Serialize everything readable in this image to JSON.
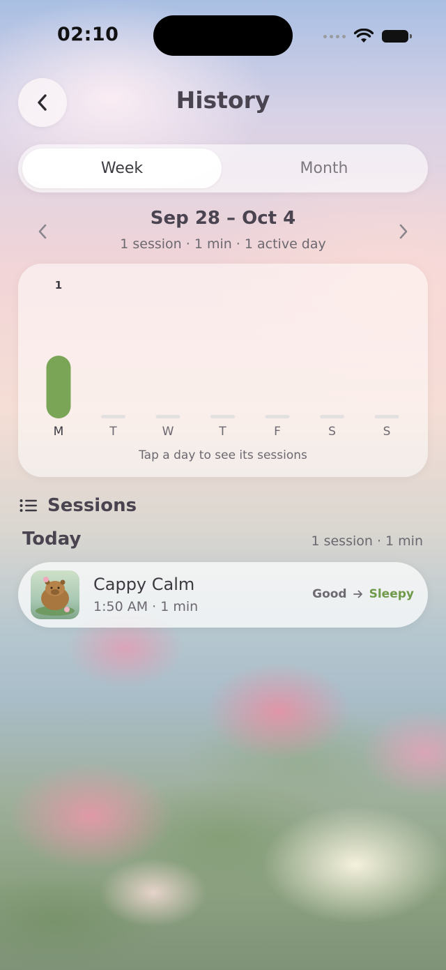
{
  "status_bar": {
    "time": "02:10"
  },
  "header": {
    "title": "History"
  },
  "tabs": {
    "week": "Week",
    "month": "Month",
    "selected": "Week"
  },
  "range": {
    "title": "Sep 28 – Oct 4",
    "summary": "1 session · 1 min · 1 active day"
  },
  "chart_data": {
    "type": "bar",
    "categories": [
      "M",
      "T",
      "W",
      "T",
      "F",
      "S",
      "S"
    ],
    "values": [
      1,
      0,
      0,
      0,
      0,
      0,
      0
    ],
    "data_labels": [
      "1",
      "",
      "",
      "",
      "",
      "",
      ""
    ],
    "ylim": [
      0,
      1
    ],
    "bar_color": "#7ba556",
    "empty_color": "#e3e0e2",
    "hint": "Tap a day to see its sessions"
  },
  "sessions": {
    "title": "Sessions",
    "groups": [
      {
        "label": "Today",
        "summary": "1 session · 1 min",
        "items": [
          {
            "title": "Cappy Calm",
            "meta": "1:50 AM · 1 min",
            "mood_before": "Good",
            "mood_after": "Sleepy"
          }
        ]
      }
    ]
  },
  "colors": {
    "accent_green": "#7ba556",
    "mood_green": "#6f9a4a",
    "title_text": "#4a4450"
  },
  "icons": {
    "back": "chevron-left-icon",
    "prev": "chevron-left-icon",
    "next": "chevron-right-icon",
    "sessions": "list-icon",
    "arrow": "arrow-right-icon"
  }
}
